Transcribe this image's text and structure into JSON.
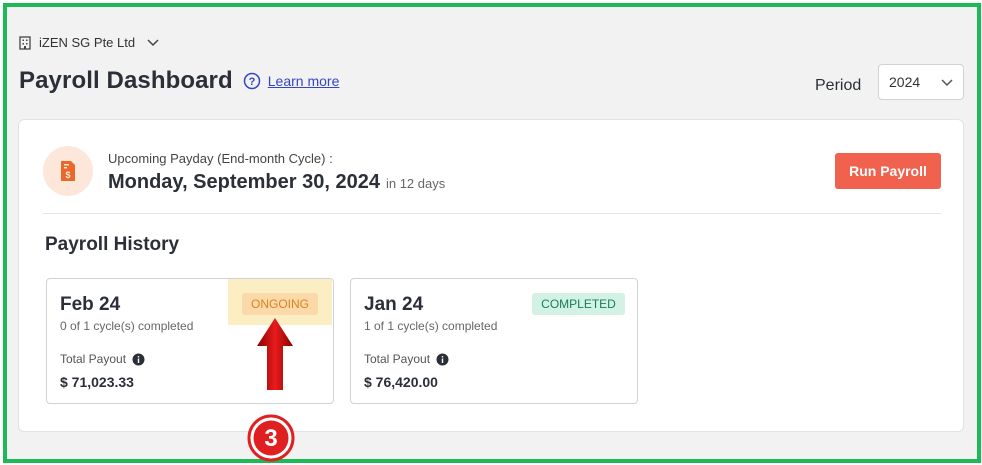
{
  "header": {
    "company_name": "iZEN SG Pte Ltd",
    "page_title": "Payroll Dashboard",
    "learn_more": "Learn more",
    "period_label": "Period",
    "period_value": "2024"
  },
  "upcoming": {
    "label": "Upcoming Payday (End-month Cycle) :",
    "date": "Monday, September 30, 2024",
    "relative": "in 12 days",
    "run_button": "Run Payroll"
  },
  "history": {
    "title": "Payroll History",
    "cards": [
      {
        "month": "Feb 24",
        "status": "ONGOING",
        "cycles": "0 of 1 cycle(s) completed",
        "payout_label": "Total Payout",
        "amount": "$ 71,023.33"
      },
      {
        "month": "Jan 24",
        "status": "COMPLETED",
        "cycles": "1 of 1 cycle(s) completed",
        "payout_label": "Total Payout",
        "amount": "$ 76,420.00"
      }
    ]
  },
  "annotation": {
    "step_number": "3"
  },
  "colors": {
    "frame": "#1db954",
    "run_button": "#f0624d",
    "ongoing_badge": "#fcd9a8",
    "completed_badge": "#d2f2e6",
    "highlight": "#fbeec2",
    "arrow": "#d81818"
  },
  "icons": [
    "building-icon",
    "chevron-down-icon",
    "help-circle-icon",
    "payday-document-icon",
    "info-icon",
    "red-arrow-icon",
    "step-number-badge"
  ]
}
